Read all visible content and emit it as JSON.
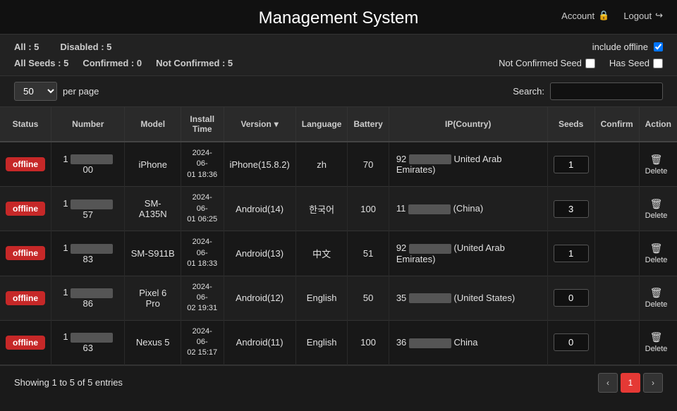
{
  "header": {
    "title": "Management System",
    "account_label": "Account",
    "logout_label": "Logout"
  },
  "toolbar": {
    "all_label": "All : 5",
    "disabled_label": "Disabled : 5",
    "include_offline_label": "include offline",
    "all_seeds_label": "All Seeds : 5",
    "confirmed_label": "Confirmed : 0",
    "not_confirmed_label": "Not Confirmed : 5",
    "not_confirmed_seed_label": "Not Confirmed Seed",
    "has_seed_label": "Has Seed"
  },
  "per_page": {
    "value": "50",
    "label": "per page",
    "search_label": "Search:",
    "search_placeholder": ""
  },
  "table": {
    "columns": [
      "Status",
      "Number",
      "Model",
      "Install Time",
      "Version",
      "Language",
      "Battery",
      "IP(Country)",
      "Seeds",
      "Confirm",
      "Action"
    ],
    "rows": [
      {
        "status": "offline",
        "number_prefix": "1",
        "number_suffix": "00",
        "model": "iPhone",
        "install_date": "2024-06-",
        "install_time": "01 18:36",
        "version": "iPhone(15.8.2)",
        "language": "zh",
        "battery": "70",
        "ip": "92",
        "country": "United Arab Emirates)",
        "seeds": "1"
      },
      {
        "status": "offline",
        "number_prefix": "1",
        "number_suffix": "57",
        "model": "SM-A135N",
        "install_date": "2024-06-",
        "install_time": "01 06:25",
        "version": "Android(14)",
        "language": "한국어",
        "battery": "100",
        "ip": "11",
        "country": "(China)",
        "seeds": "3"
      },
      {
        "status": "offline",
        "number_prefix": "1",
        "number_suffix": "83",
        "model": "SM-S911B",
        "install_date": "2024-06-",
        "install_time": "01 18:33",
        "version": "Android(13)",
        "language": "中文",
        "battery": "51",
        "ip": "92",
        "country": "(United Arab Emirates)",
        "seeds": "1"
      },
      {
        "status": "offline",
        "number_prefix": "1",
        "number_suffix": "86",
        "model": "Pixel 6 Pro",
        "install_date": "2024-06-",
        "install_time": "02 19:31",
        "version": "Android(12)",
        "language": "English",
        "battery": "50",
        "ip": "35",
        "country": "(United States)",
        "seeds": "0"
      },
      {
        "status": "offline",
        "number_prefix": "1",
        "number_suffix": "63",
        "model": "Nexus 5",
        "install_date": "2024-06-",
        "install_time": "02 15:17",
        "version": "Android(11)",
        "language": "English",
        "battery": "100",
        "ip": "36",
        "country": "China",
        "seeds": "0"
      }
    ]
  },
  "footer": {
    "showing_label": "Showing 1 to 5 of 5 entries",
    "prev_label": "‹",
    "page_label": "1",
    "next_label": "›"
  }
}
